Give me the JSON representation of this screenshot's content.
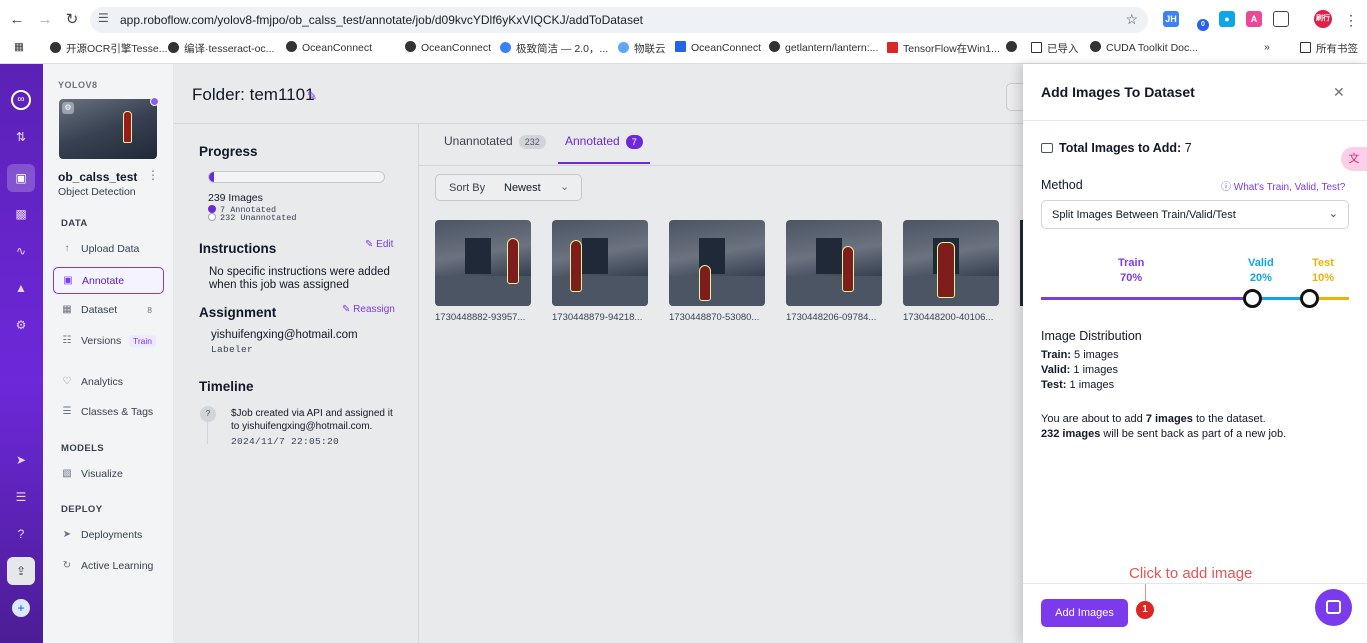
{
  "browser": {
    "url": "app.roboflow.com/yolov8-fmjpo/ob_calss_test/annotate/job/d09kvcYDlf6yKxVIQCKJ/addToDataset",
    "bookmarks": [
      "开源OCR引擎Tesse...",
      "编译·tesseract-oc...",
      "OceanConnect",
      "OceanConnect",
      "极致简洁 — 2.0，...",
      "物联云",
      "OceanConnect",
      "getlantern/lantern:...",
      "TensorFlow在Win1...",
      "已导入",
      "CUDA Toolkit Doc...",
      "所有书签"
    ],
    "ext_badge": "0",
    "profile": "刷行"
  },
  "sidebar": {
    "workspace": "YOLOV8",
    "project_name": "ob_calss_test",
    "project_type": "Object Detection",
    "data_header": "DATA",
    "models_header": "MODELS",
    "deploy_header": "DEPLOY",
    "items": {
      "upload": "Upload Data",
      "annotate": "Annotate",
      "dataset": "Dataset",
      "dataset_count": "8",
      "versions": "Versions",
      "versions_badge": "Train",
      "analytics": "Analytics",
      "classes": "Classes & Tags",
      "visualize": "Visualize",
      "deployments": "Deployments",
      "active_learning": "Active Learning"
    }
  },
  "header": {
    "folder_title": "Folder: tem1101"
  },
  "job_panel": {
    "progress_title": "Progress",
    "progress_fraction": 0.029,
    "total_images": "239 Images",
    "annotated": "7 Annotated",
    "unannotated": "232 Unannotated",
    "instructions_title": "Instructions",
    "edit_label": "Edit",
    "instructions_text": "No specific instructions were added when this job was assigned",
    "assignment_title": "Assignment",
    "reassign_label": "Reassign",
    "assignee": "yishuifengxing@hotmail.com",
    "role": "Labeler",
    "timeline_title": "Timeline",
    "timeline_icon": "?",
    "timeline_text": "$Job created via API and assigned it to yishuifengxing@hotmail.com.",
    "timeline_time": "2024/11/7 22:05:20"
  },
  "content": {
    "tabs": [
      {
        "label": "Unannotated",
        "count": "232"
      },
      {
        "label": "Annotated",
        "count": "7"
      }
    ],
    "sort_label": "Sort By",
    "sort_value": "Newest",
    "images": [
      "1730448882-93957...",
      "1730448879-94218...",
      "1730448870-53080...",
      "1730448206-09784...",
      "1730448200-40106..."
    ]
  },
  "drawer": {
    "title": "Add Images To Dataset",
    "total_label": "Total Images to Add:",
    "total_value": "7",
    "method_label": "Method",
    "help_link": "What's Train, Valid, Test?",
    "method_value": "Split Images Between Train/Valid/Test",
    "split": [
      {
        "name": "Train",
        "pct": "70%",
        "color": "#7c3aed"
      },
      {
        "name": "Valid",
        "pct": "20%",
        "color": "#0ea5e9"
      },
      {
        "name": "Test",
        "pct": "10%",
        "color": "#eab308"
      }
    ],
    "dist_title": "Image Distribution",
    "dist": [
      {
        "label": "Train:",
        "value": "5 images"
      },
      {
        "label": "Valid:",
        "value": "1 images"
      },
      {
        "label": "Test:",
        "value": "1 images"
      }
    ],
    "summary_1_pre": "You are about to add",
    "summary_1_bold": "7 images",
    "summary_1_post": "to the dataset.",
    "summary_2_bold": "232 images",
    "summary_2_post": "will be sent back as part of a new job.",
    "add_button": "Add Images"
  },
  "annotation": {
    "text": "Click to add image",
    "badge": "1"
  },
  "colors": {
    "brand": "#7c3aed",
    "train": "#7c3aed",
    "valid": "#0ea5e9",
    "test": "#eab308",
    "callout": "#dc2626"
  }
}
